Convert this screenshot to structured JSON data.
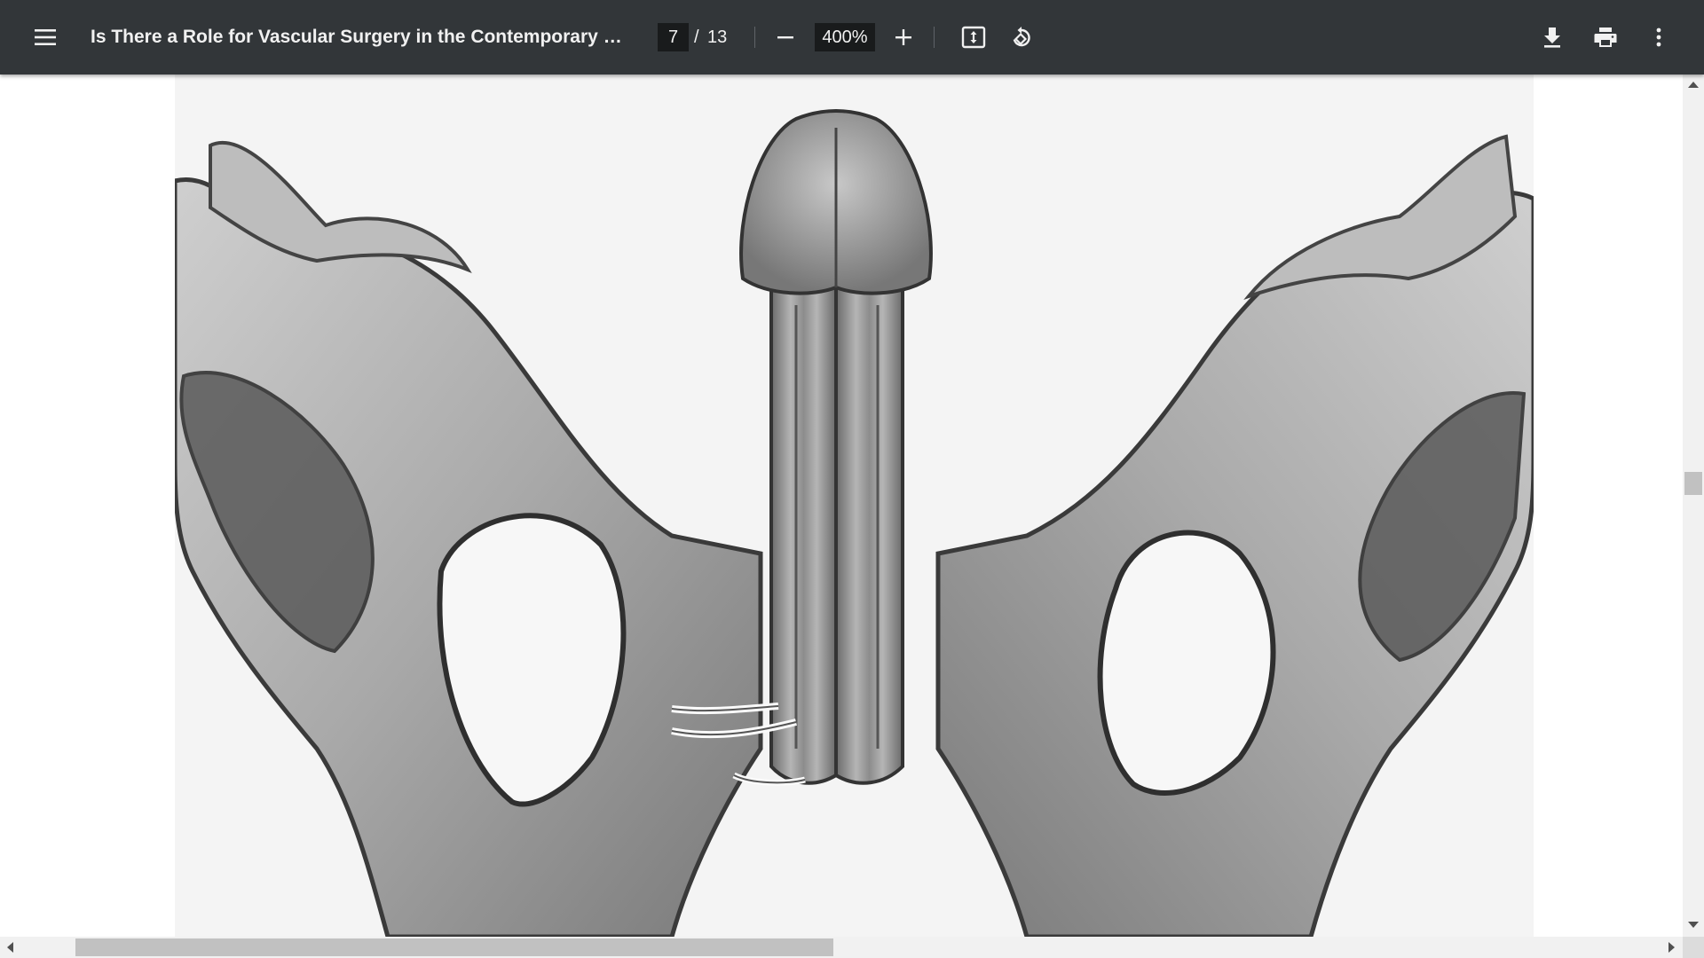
{
  "toolbar": {
    "menu_icon": "hamburger-menu-icon",
    "title": "Is There a Role for Vascular Surgery in the Contemporary Mana...",
    "page_current": "7",
    "page_separator": "/",
    "page_total": "13",
    "zoom_out_icon": "minus-icon",
    "zoom_value": "400%",
    "zoom_in_icon": "plus-icon",
    "fit_icon": "fit-to-page-icon",
    "rotate_icon": "rotate-counterclockwise-icon",
    "download_icon": "download-icon",
    "print_icon": "print-icon",
    "more_icon": "more-vertical-icon"
  },
  "document": {
    "image_subject": "pencil sketch anatomical illustration (grayscale)"
  },
  "scrollbars": {
    "vertical_position_fraction": 0.47,
    "horizontal_visible_fraction": 0.45
  },
  "colors": {
    "toolbar_bg": "#323639",
    "toolbar_text": "#f1f1f1",
    "input_bg": "#191b1c",
    "scrollbar_track": "#f1f1f1",
    "scrollbar_thumb": "#c1c1c1"
  }
}
